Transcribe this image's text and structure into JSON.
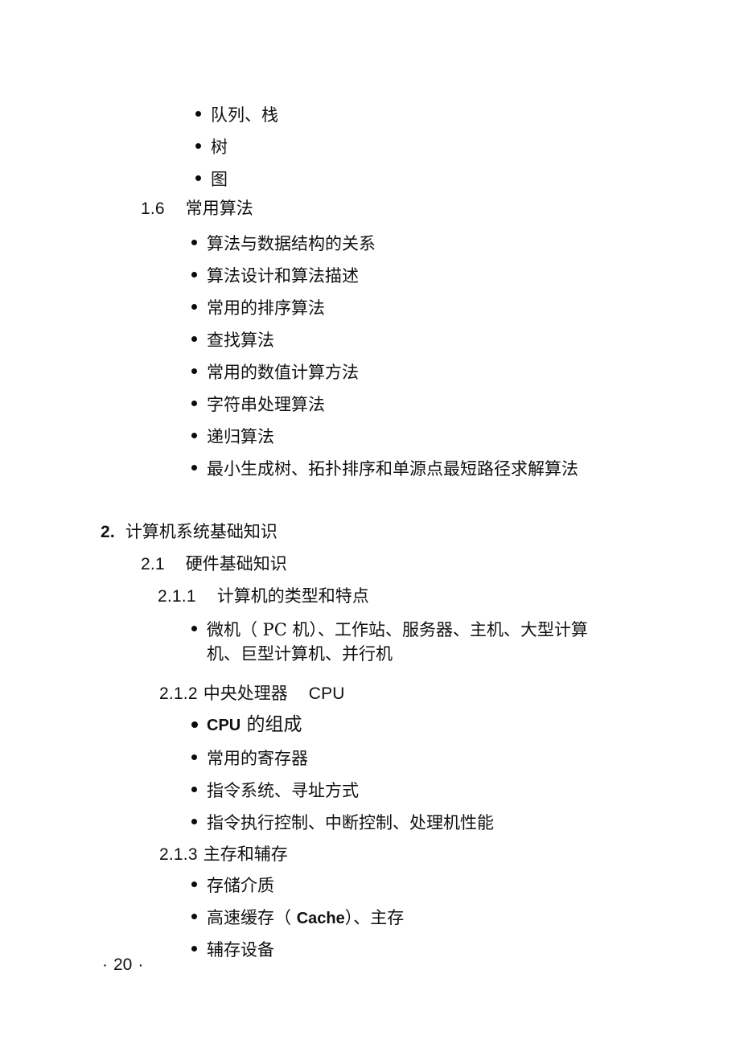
{
  "document": {
    "page_number": "20",
    "footer_left_mark": "·",
    "footer_right_mark": "·"
  },
  "blocks": {
    "top_bullets": [
      {
        "text": "队列、栈"
      },
      {
        "text": "树"
      },
      {
        "text": "图"
      }
    ],
    "section_1_6": {
      "number": "1.6",
      "title": "常用算法",
      "bullets": [
        {
          "text": "算法与数据结构的关系"
        },
        {
          "text": "算法设计和算法描述"
        },
        {
          "text": "常用的排序算法"
        },
        {
          "text": "查找算法"
        },
        {
          "text": "常用的数值计算方法"
        },
        {
          "text": "字符串处理算法"
        },
        {
          "text": "递归算法"
        },
        {
          "text": "最小生成树、拓扑排序和单源点最短路径求解算法"
        }
      ]
    },
    "chapter_2": {
      "number": "2.",
      "title": "计算机系统基础知识",
      "section_2_1": {
        "number": "2.1",
        "title": "硬件基础知识",
        "sub_2_1_1": {
          "number": "2.1.1",
          "title": "计算机的类型和特点",
          "bullets": [
            {
              "text": "微机（ PC 机）、工作站、服务器、主机、大型计算机、巨型计算机、并行机"
            }
          ]
        },
        "sub_2_1_2": {
          "number": "2.1.2",
          "title": "中央处理器",
          "title_suffix": "CPU",
          "bullets": [
            {
              "text_latin": "CPU",
              "text_cjk": "的组成"
            },
            {
              "text": "常用的寄存器"
            },
            {
              "text": "指令系统、寻址方式"
            },
            {
              "text": "指令执行控制、中断控制、处理机性能"
            }
          ]
        },
        "sub_2_1_3": {
          "number": "2.1.3",
          "title": "主存和辅存",
          "bullets": [
            {
              "text": "存储介质"
            },
            {
              "text_pre": "高速缓存（",
              "text_latin": "Cache",
              "text_post": "）、主存"
            },
            {
              "text": "辅存设备"
            }
          ]
        }
      }
    }
  }
}
